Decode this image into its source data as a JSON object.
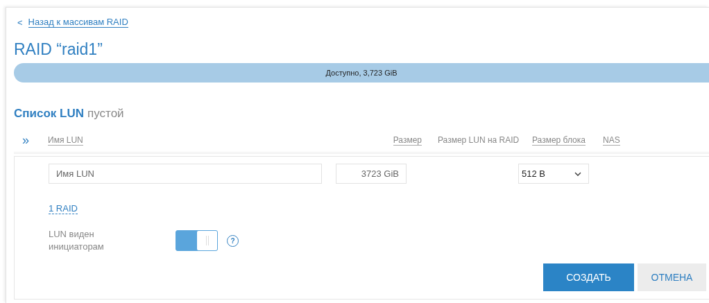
{
  "back_link": {
    "icon": "<",
    "label": "Назад к массивам RAID"
  },
  "title": "RAID “raid1”",
  "capacity_bar": {
    "label": "Доступно, 3,723 GiB"
  },
  "lun_list": {
    "heading": "Список LUN",
    "status": "пустой"
  },
  "table": {
    "expand_icon": "»",
    "columns": [
      {
        "label": "Имя LUN",
        "sortable": true
      },
      {
        "label": "Размер",
        "sortable": true
      },
      {
        "label": "Размер LUN на RAID",
        "sortable": false
      },
      {
        "label": "Размер блока",
        "sortable": true
      },
      {
        "label": "NAS",
        "sortable": true
      }
    ]
  },
  "form": {
    "name_field": {
      "placeholder": "Имя LUN"
    },
    "size_field": {
      "value": "3723 GiB"
    },
    "block_size_select": {
      "value": "512 B"
    },
    "raid_link": "1 RAID",
    "visibility": {
      "label": "LUN виден инициаторам",
      "on": true,
      "help_icon": "?"
    },
    "buttons": [
      {
        "label": "СОЗДАТЬ",
        "kind": "primary"
      },
      {
        "label": "ОТМЕНА",
        "kind": "secondary"
      }
    ]
  }
}
